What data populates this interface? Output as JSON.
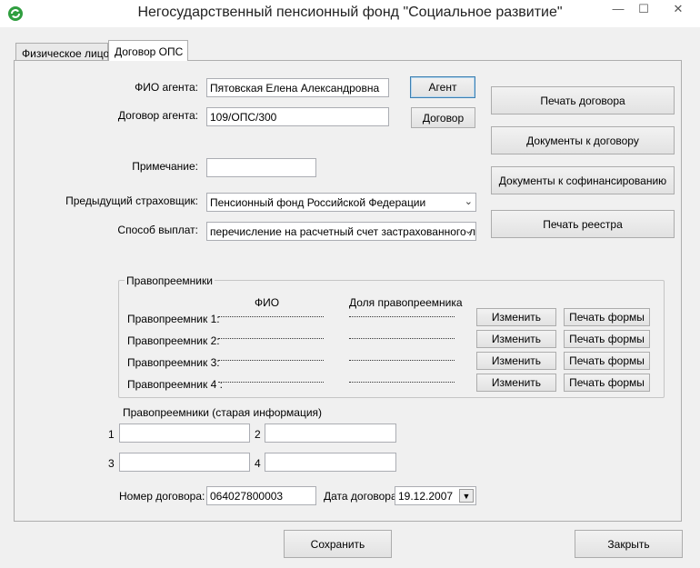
{
  "window": {
    "title": "Негосударственный пенсионный фонд \"Социальное развитие\"",
    "icon": "green-refresh-icon",
    "minimize_glyph": "—",
    "maximize_glyph": "☐",
    "close_glyph": "✕"
  },
  "tabs": [
    {
      "label": "Физическое лицо",
      "active": false
    },
    {
      "label": "Договор ОПС",
      "active": true
    }
  ],
  "form": {
    "agent_fio_label": "ФИО агента:",
    "agent_fio_value": "Пятовская Елена Александровна",
    "agent_contract_label": "Договор агента:",
    "agent_contract_value": "109/ОПС/300",
    "note_label": "Примечание:",
    "note_value": "",
    "prev_insurer_label": "Предыдущий страховщик:",
    "prev_insurer_value": "Пенсионный фонд Российской Федерации",
    "payment_method_label": "Способ выплат:",
    "payment_method_value": "перечисление на расчетный счет застрахованного ли",
    "agent_button": "Агент",
    "contract_button": "Договор"
  },
  "actions": {
    "print_contract": "Печать договора",
    "contract_docs": "Документы к договору",
    "cofinancing_docs": "Документы к софинансированию",
    "print_register": "Печать реестра"
  },
  "successors": {
    "group_title": "Правопреемники",
    "col_fio": "ФИО",
    "col_share": "Доля правопреемника",
    "rows": [
      {
        "label": "Правопреемник 1:",
        "edit": "Изменить",
        "print": "Печать формы"
      },
      {
        "label": "Правопреемник 2:",
        "edit": "Изменить",
        "print": "Печать формы"
      },
      {
        "label": "Правопреемник 3:",
        "edit": "Изменить",
        "print": "Печать формы"
      },
      {
        "label": "Правопреемник 4 :",
        "edit": "Изменить",
        "print": "Печать формы"
      }
    ]
  },
  "old_successors": {
    "title": "Правопреемники (старая информация)",
    "n1": "1",
    "n2": "2",
    "n3": "3",
    "n4": "4",
    "v1": "",
    "v2": "",
    "v3": "",
    "v4": ""
  },
  "contract": {
    "number_label": "Номер договора:",
    "number_value": "064027800003",
    "date_label": "Дата договора:",
    "date_value": "19.12.2007"
  },
  "footer": {
    "save": "Сохранить",
    "close": "Закрыть"
  }
}
